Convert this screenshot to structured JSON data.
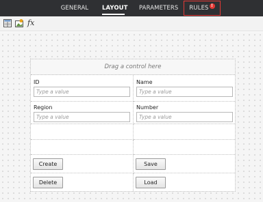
{
  "tabs": [
    {
      "label": "GENERAL",
      "active": false
    },
    {
      "label": "LAYOUT",
      "active": true
    },
    {
      "label": "PARAMETERS",
      "active": false
    },
    {
      "label": "RULES",
      "active": false,
      "badge": "!",
      "highlight_color": "#e53935"
    }
  ],
  "toolbar": {
    "icons": [
      "grid-layout-icon",
      "add-image-icon",
      "formula-icon"
    ],
    "formula_label": "fx"
  },
  "form": {
    "drop_hint": "Drag a control here",
    "fields": [
      {
        "label": "ID",
        "placeholder": "Type a value"
      },
      {
        "label": "Name",
        "placeholder": "Type a value"
      },
      {
        "label": "Region",
        "placeholder": "Type a value"
      },
      {
        "label": "Number",
        "placeholder": "Type a value"
      }
    ],
    "buttons": [
      {
        "label": "Create"
      },
      {
        "label": "Save"
      },
      {
        "label": "Delete"
      },
      {
        "label": "Load"
      }
    ]
  },
  "colors": {
    "topbar": "#2f3033",
    "alert": "#e53935"
  }
}
